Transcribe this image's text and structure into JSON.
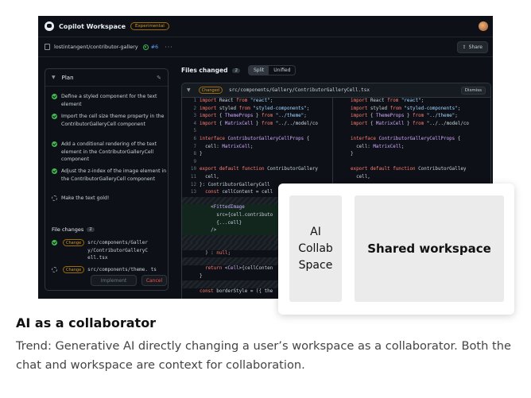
{
  "app": {
    "title": "Copilot Workspace",
    "badge": "Experimental",
    "repo": "lostintangent/contributor-gallery",
    "issue": "#6",
    "share": "Share"
  },
  "plan": {
    "title": "Plan",
    "steps": [
      {
        "text": "Define a styled component for the text element",
        "done": true
      },
      {
        "text": "Import the cell size theme property in the ContributorGalleryCell component",
        "done": true
      },
      {
        "text": "Add a conditional rendering of the text element in the ContributorGalleryCell component",
        "done": true
      },
      {
        "text": "Adjust the z-index of the image element in the ContributorGalleryCell component",
        "done": true
      },
      {
        "text": "Make the text gold!",
        "done": false
      }
    ],
    "file_changes_label": "File changes",
    "file_changes_count": "2",
    "files": [
      {
        "tag": "Change",
        "path": "src/components/Galler y/ContributorGalleryC ell.tsx"
      },
      {
        "tag": "Change",
        "path": "src/components/theme. ts"
      }
    ],
    "implement": "Implement",
    "cancel": "Cancel"
  },
  "diff": {
    "title": "Files changed",
    "count": "2",
    "split": "Split",
    "unified": "Unified",
    "tag": "Changed",
    "path": "src/components/Gallery/ContributorGalleryCell.tsx",
    "dismiss": "Dismiss",
    "left": [
      {
        "n": "1",
        "c": "import React from \"react\";"
      },
      {
        "n": "2",
        "c": "import styled from \"styled-components\";"
      },
      {
        "n": "3",
        "c": "import { ThemeProps } from \"../theme\";"
      },
      {
        "n": "4",
        "c": "import { MatrixCell } from \"../../model/co"
      },
      {
        "n": "5",
        "c": ""
      },
      {
        "n": "6",
        "c": "interface ContributorGalleryCellProps {"
      },
      {
        "n": "7",
        "c": "  cell: MatrixCell;"
      },
      {
        "n": "8",
        "c": "}"
      },
      {
        "n": "9",
        "c": ""
      },
      {
        "n": "10",
        "c": "export default function ContributorGallery"
      },
      {
        "n": "11",
        "c": "  cell,"
      },
      {
        "n": "12",
        "c": "}: ContributorGalleryCell"
      },
      {
        "n": "13",
        "c": "  const cellContent = cell"
      },
      {
        "n": "",
        "c": ""
      },
      {
        "n": "",
        "c": "    <FittedImage"
      },
      {
        "n": "",
        "c": "      src={cell.contributo"
      },
      {
        "n": "",
        "c": "      {...cell}"
      },
      {
        "n": "",
        "c": "    />"
      },
      {
        "n": "",
        "c": ""
      },
      {
        "n": "",
        "c": ""
      },
      {
        "n": "",
        "c": "  ) : null;"
      },
      {
        "n": "",
        "c": ""
      },
      {
        "n": "",
        "c": "  return <Cell>{cellConten"
      },
      {
        "n": "",
        "c": "}"
      },
      {
        "n": "",
        "c": ""
      },
      {
        "n": "",
        "c": "const borderStyle = ({ the"
      }
    ],
    "right": [
      {
        "n": "",
        "c": "import React from \"react\";"
      },
      {
        "n": "",
        "c": "import styled from \"styled-components\";"
      },
      {
        "n": "",
        "c": "import { ThemeProps } from \"../theme\";"
      },
      {
        "n": "",
        "c": "import { MatrixCell } from \"../../model/co"
      },
      {
        "n": "",
        "c": ""
      },
      {
        "n": "",
        "c": "interface ContributorGalleryCellProps {"
      },
      {
        "n": "",
        "c": "  cell: MatrixCell;"
      },
      {
        "n": "",
        "c": "}"
      },
      {
        "n": "",
        "c": ""
      },
      {
        "n": "",
        "c": "export default function ContributorGalley"
      },
      {
        "n": "",
        "c": "  cell,"
      }
    ]
  },
  "overlay": {
    "ai_box": "AI\nCollab\nSpace",
    "workspace_box": "Shared workspace"
  },
  "caption": {
    "heading": "AI as a collaborator",
    "body": "Trend: Generative AI directly changing a user’s workspace as a collaborator. Both the chat and workspace are context for collaboration."
  }
}
